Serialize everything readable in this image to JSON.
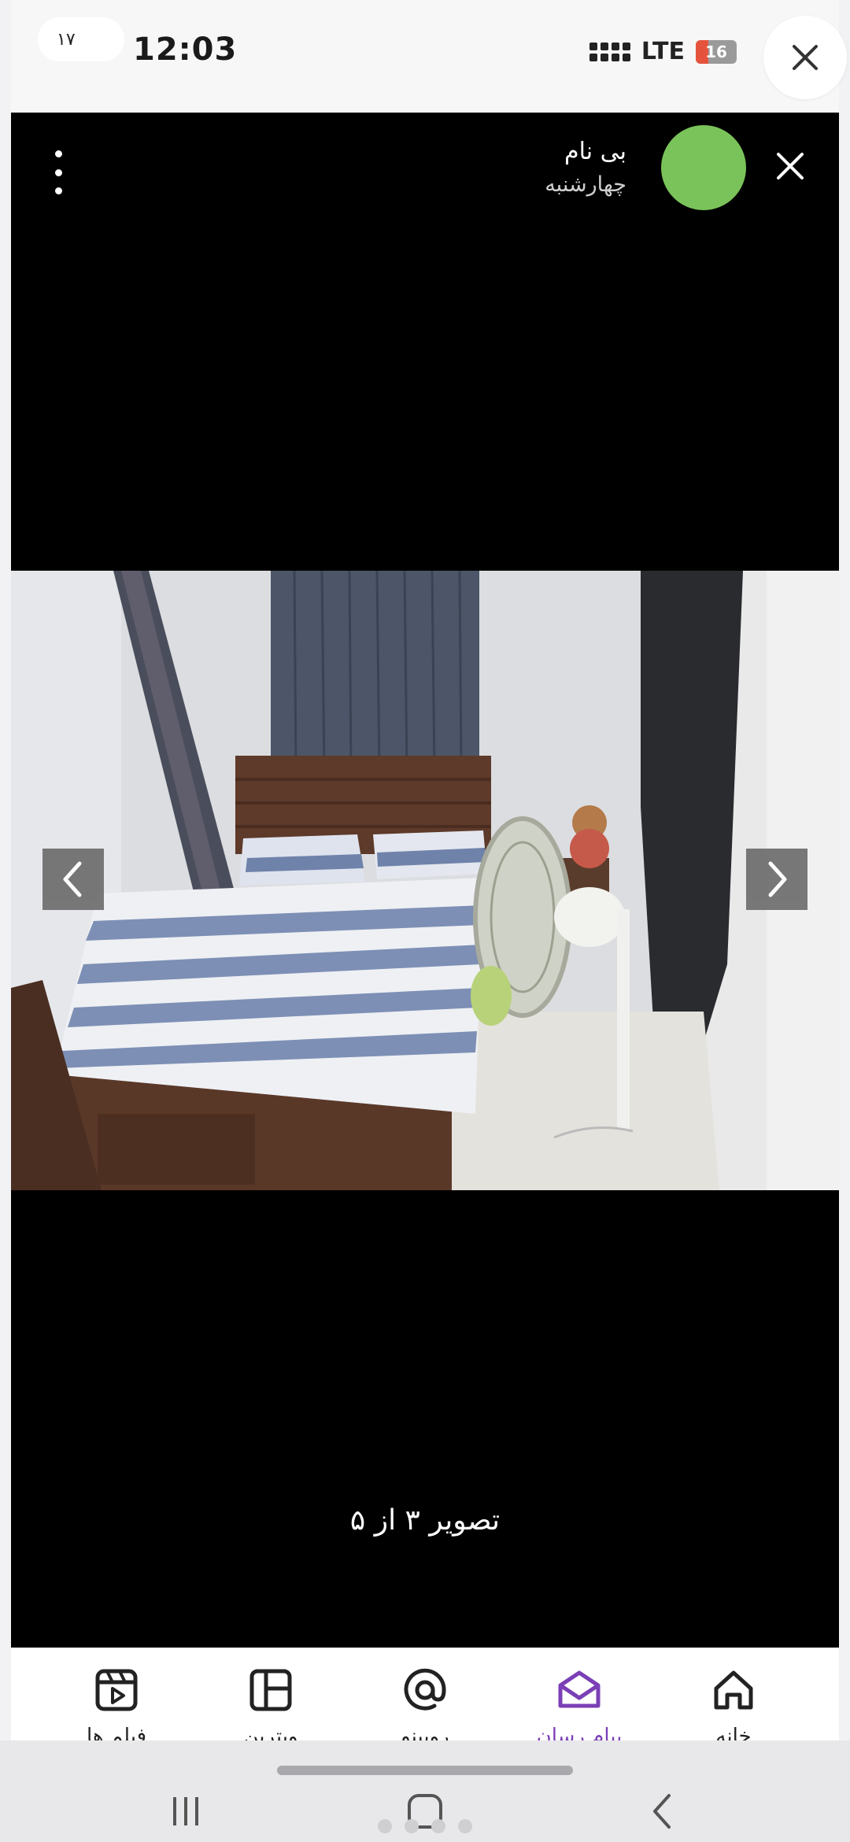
{
  "status_bar": {
    "notification_count": "۱۷",
    "time": "12:03",
    "network": "LTE",
    "battery": "16"
  },
  "viewer": {
    "user_name": "بی نام",
    "user_date": "چهارشنبه",
    "avatar_color": "#7ac35a",
    "image_index": 3,
    "image_total": 5,
    "caption": "تصویر ۳ از ۵"
  },
  "bottom_nav": {
    "items": [
      {
        "label": "خانه",
        "icon": "home-icon",
        "active": false
      },
      {
        "label": "پیام رسان",
        "icon": "messenger-icon",
        "active": true
      },
      {
        "label": "روبینو",
        "icon": "at-sign-icon",
        "active": false
      },
      {
        "label": "ویترین",
        "icon": "storefront-icon",
        "active": false
      },
      {
        "label": "فیلم ها",
        "icon": "film-icon",
        "active": false
      }
    ],
    "active_color": "#7b3fb6"
  }
}
